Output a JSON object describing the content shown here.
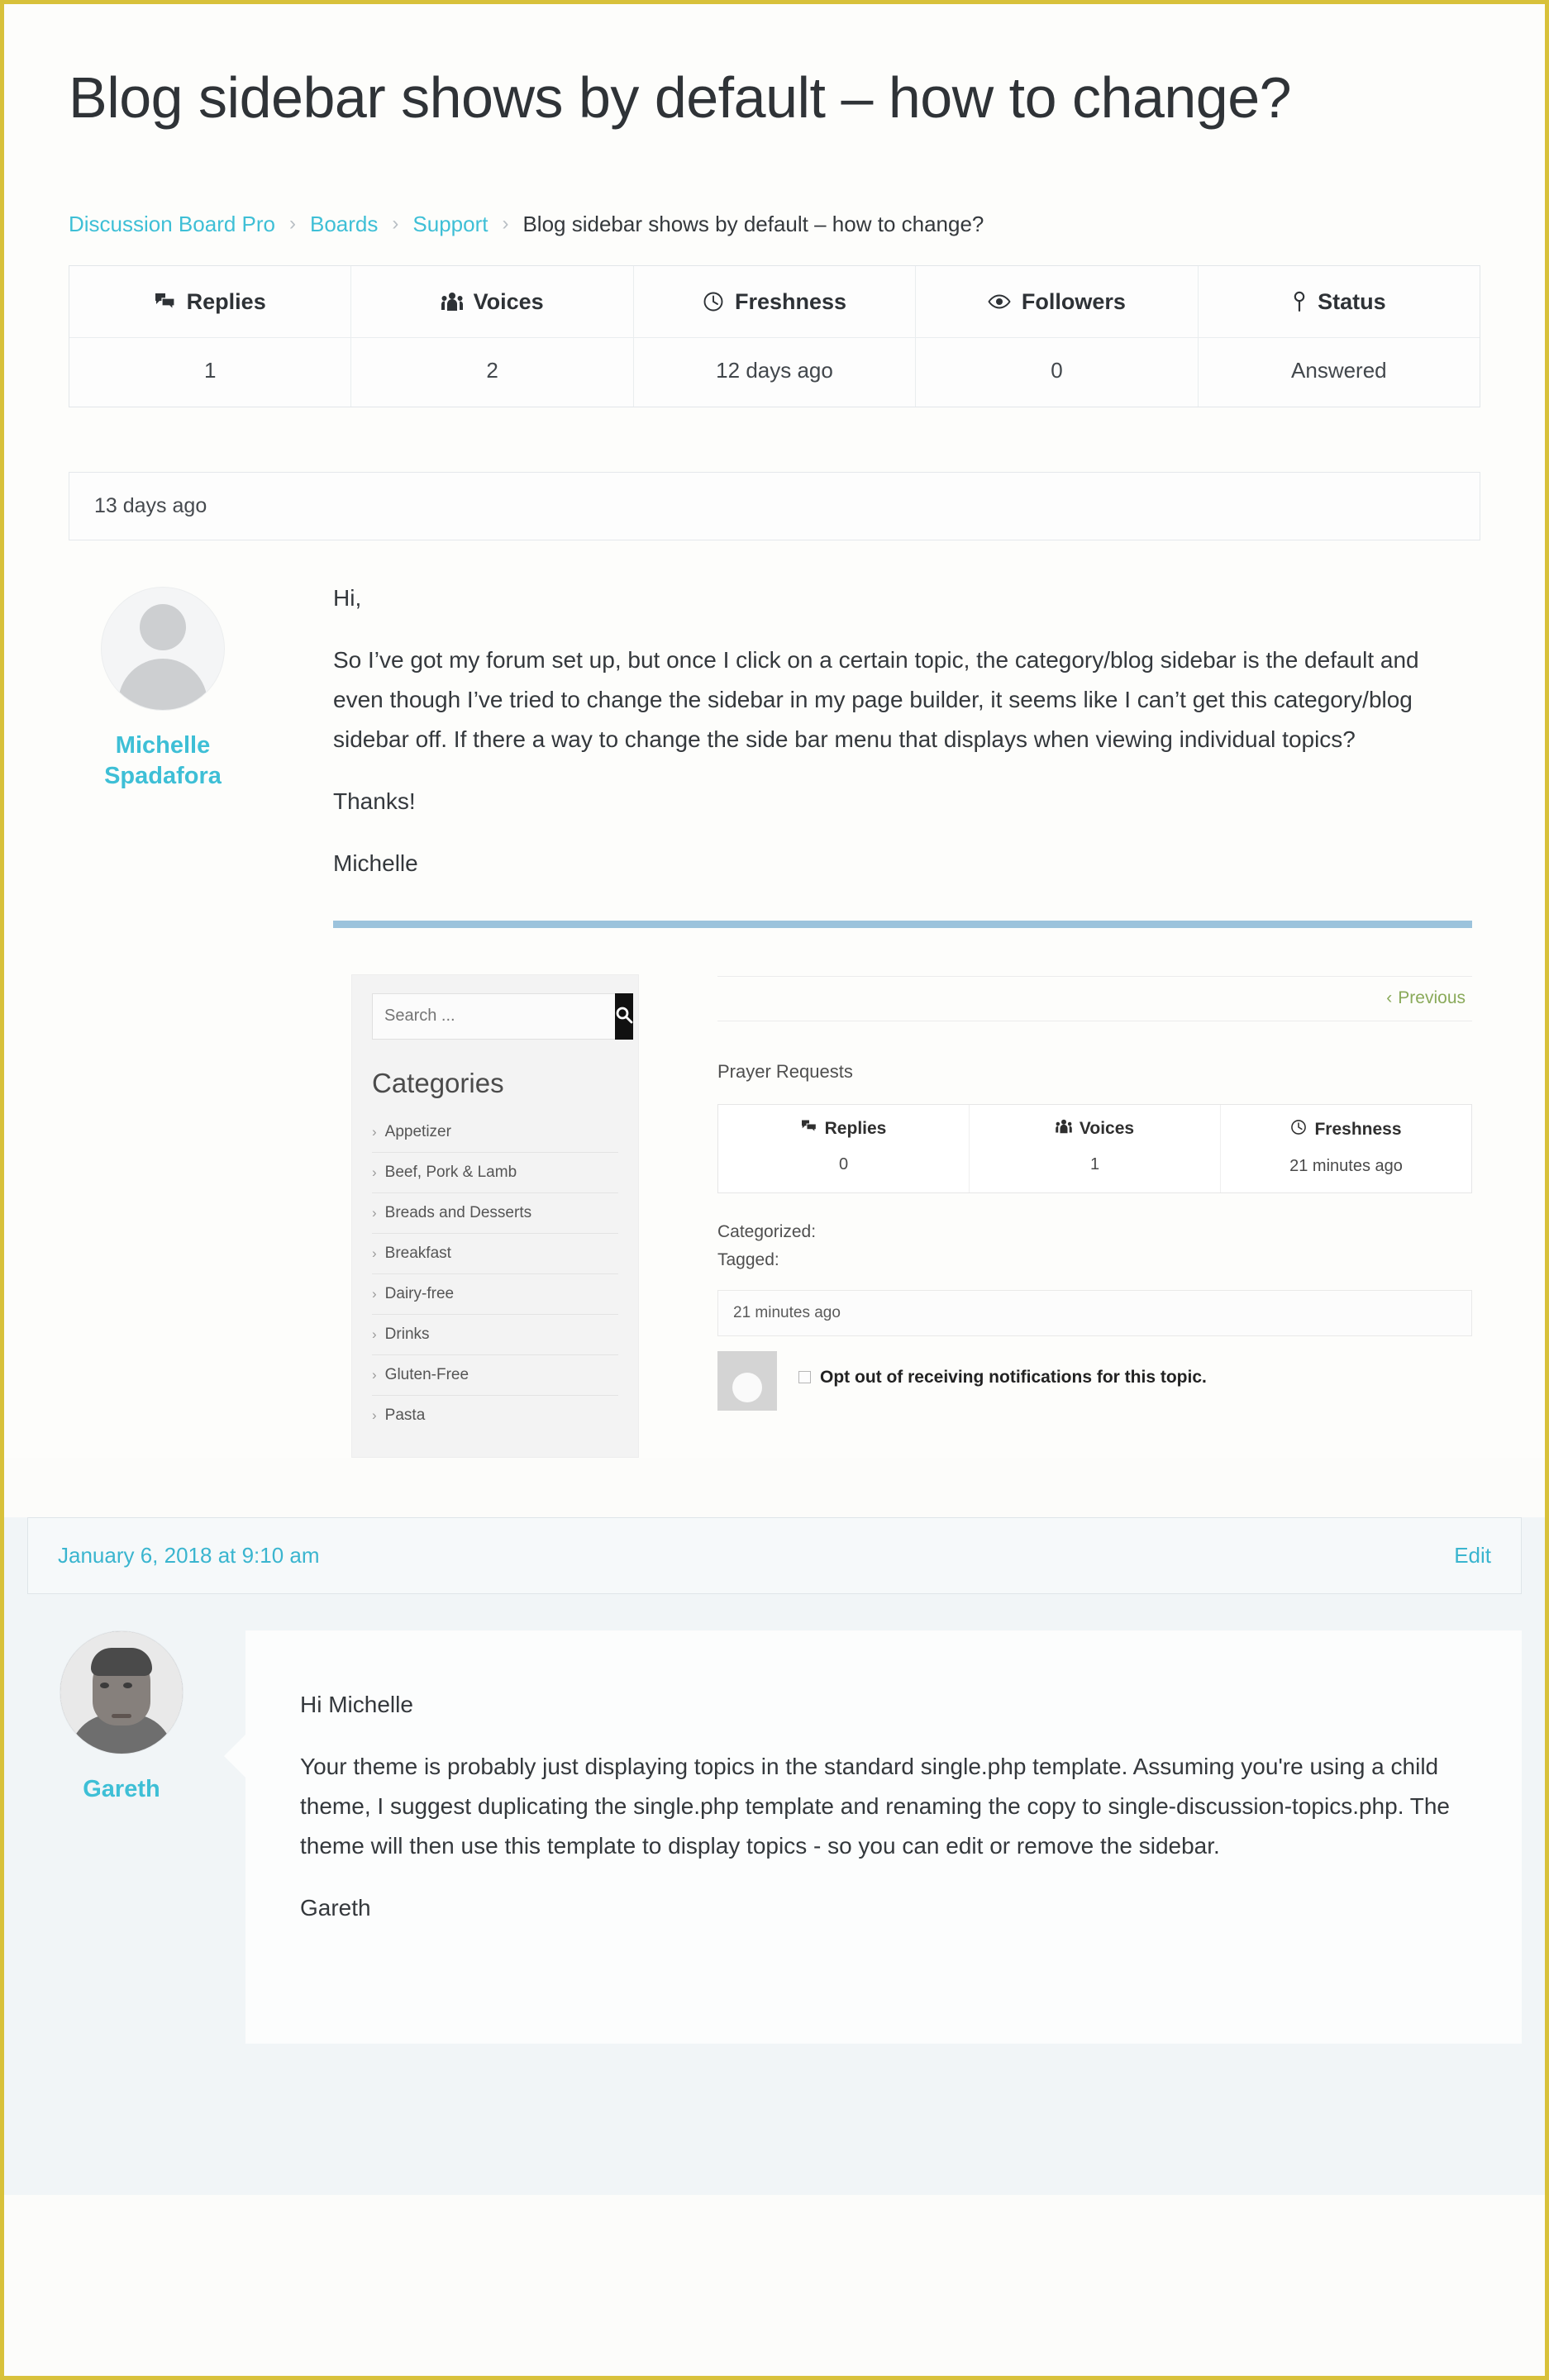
{
  "page": {
    "title": "Blog sidebar shows by default – how to change?"
  },
  "breadcrumb": {
    "items": [
      {
        "label": "Discussion Board Pro",
        "link": true
      },
      {
        "label": "Boards",
        "link": true
      },
      {
        "label": "Support",
        "link": true
      },
      {
        "label": "Blog sidebar shows by default – how to change?",
        "link": false
      }
    ],
    "separator": "›"
  },
  "topic_stats": {
    "columns": [
      {
        "icon": "replies-icon",
        "label": "Replies",
        "value": "1"
      },
      {
        "icon": "voices-icon",
        "label": "Voices",
        "value": "2"
      },
      {
        "icon": "clock-icon",
        "label": "Freshness",
        "value": "12 days ago"
      },
      {
        "icon": "eye-icon",
        "label": "Followers",
        "value": "0"
      },
      {
        "icon": "pin-icon",
        "label": "Status",
        "value": "Answered"
      }
    ]
  },
  "original_post": {
    "timestamp": "13 days ago",
    "author": {
      "name_line1": "Michelle",
      "name_line2": "Spadafora"
    },
    "paragraphs": [
      "Hi,",
      "So I’ve got my forum set up, but once I click on a certain topic, the category/blog sidebar is the default and even though I’ve tried to change the sidebar in my page builder, it seems like I can’t get this category/blog sidebar off. If there a way to change the side bar menu that displays when viewing individual topics?",
      "Thanks!",
      "Michelle"
    ]
  },
  "embedded_screenshot": {
    "sidebar": {
      "search_placeholder": "Search ...",
      "search_button_icon": "search-icon",
      "categories_title": "Categories",
      "categories": [
        "Appetizer",
        "Beef, Pork & Lamb",
        "Breads and Desserts",
        "Breakfast",
        "Dairy-free",
        "Drinks",
        "Gluten-Free",
        "Pasta"
      ],
      "chevron": "›"
    },
    "main": {
      "previous_label": "Previous",
      "previous_chevron": "‹",
      "forum_name": "Prayer Requests",
      "stats": {
        "columns": [
          {
            "icon": "replies-icon",
            "label": "Replies",
            "value": "0"
          },
          {
            "icon": "voices-icon",
            "label": "Voices",
            "value": "1"
          },
          {
            "icon": "clock-icon",
            "label": "Freshness",
            "value": "21 minutes ago"
          }
        ]
      },
      "categorized_label": "Categorized:",
      "tagged_label": "Tagged:",
      "reply_timestamp": "21 minutes ago",
      "optout_label": "Opt out of receiving notifications for this topic."
    }
  },
  "reply": {
    "timestamp": "January 6, 2018 at 9:10 am",
    "edit_label": "Edit",
    "author": {
      "name": "Gareth"
    },
    "paragraphs": [
      "Hi Michelle",
      "Your theme is probably just displaying topics in the standard single.php template. Assuming you're using a child theme, I suggest duplicating the single.php template and renaming the copy to single-discussion-topics.php. The theme will then use this template to display topics - so you can edit or remove the sidebar.",
      "Gareth"
    ]
  },
  "colors": {
    "accent": "#3ebfd6",
    "rule": "#9cc3dc",
    "frame_border": "#d8c13a",
    "reply_bg": "#f1f5f7",
    "previous_link": "#8aaa5a"
  }
}
